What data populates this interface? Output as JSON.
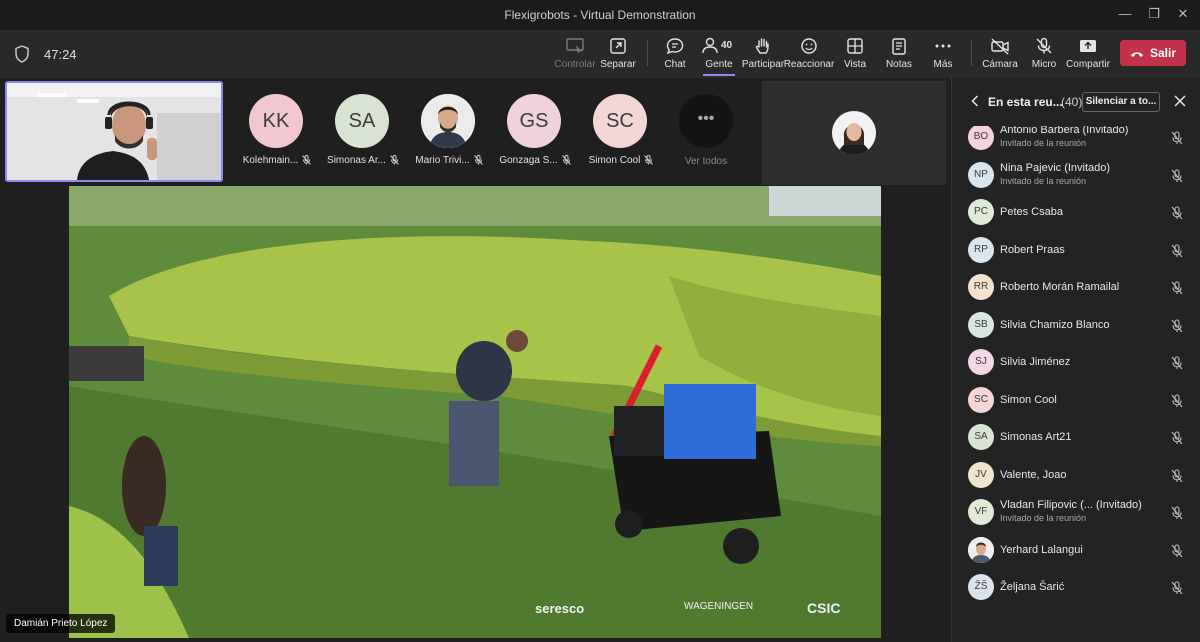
{
  "window": {
    "title": "Flexigrobots - Virtual Demonstration"
  },
  "toolbar": {
    "timer": "47:24",
    "items": [
      {
        "label": "Controlar",
        "icon": "control-icon"
      },
      {
        "label": "Separar",
        "icon": "popout-icon"
      },
      {
        "label": "Chat",
        "icon": "chat-icon"
      },
      {
        "label": "Gente",
        "icon": "people-icon",
        "count": "40"
      },
      {
        "label": "Participar",
        "icon": "raise-hand-icon"
      },
      {
        "label": "Reaccionar",
        "icon": "smiley-icon"
      },
      {
        "label": "Vista",
        "icon": "view-grid-icon"
      },
      {
        "label": "Notas",
        "icon": "notes-icon"
      },
      {
        "label": "Más",
        "icon": "more-icon"
      },
      {
        "label": "Cámara",
        "icon": "camera-off-icon"
      },
      {
        "label": "Micro",
        "icon": "mic-off-icon"
      },
      {
        "label": "Compartir",
        "icon": "share-icon"
      }
    ],
    "leave_label": "Salir"
  },
  "stage": {
    "participants": [
      {
        "initials": "KK",
        "name": "Kolehmain...",
        "color": "#f3c7cf"
      },
      {
        "initials": "SA",
        "name": "Simonas Ar...",
        "color": "#d9e3d3"
      },
      {
        "initials": "",
        "name": "Mario Trivi...",
        "color": "#f0f0f0"
      },
      {
        "initials": "GS",
        "name": "Gonzaga S...",
        "color": "#efd2dd"
      },
      {
        "initials": "SC",
        "name": "Simon Cool",
        "color": "#f5d6d6"
      }
    ],
    "see_all_label": "Ver todos",
    "presenter_name": "Damián Prieto López",
    "video_logos": [
      "seresco",
      "WAGENINGEN",
      "CSIC"
    ]
  },
  "panel": {
    "title": "En esta reu...",
    "count": "(40)",
    "mute_all_label": "Silenciar a to...",
    "people": [
      {
        "initials": "BO",
        "name": "Antonio Barberá",
        "suffix": "(Invitado)",
        "sub": "Invitado de la reunión",
        "color": "#f3d2dc"
      },
      {
        "initials": "NP",
        "name": "Nina Pajevic (Invitado)",
        "sub": "Invitado de la reunión",
        "color": "#d9e4ee"
      },
      {
        "initials": "PC",
        "name": "Petes Csaba",
        "sub": "",
        "color": "#e0ead8"
      },
      {
        "initials": "RP",
        "name": "Robert Praas",
        "sub": "",
        "color": "#dbe5ee"
      },
      {
        "initials": "RR",
        "name": "Roberto Morán Ramailal",
        "sub": "",
        "color": "#f5e2cf"
      },
      {
        "initials": "SB",
        "name": "Silvia Chamizo Blanco",
        "sub": "",
        "color": "#d9e6df"
      },
      {
        "initials": "SJ",
        "name": "Silvia Jiménez",
        "sub": "",
        "color": "#f3d7e6"
      },
      {
        "initials": "SC",
        "name": "Simon Cool",
        "sub": "",
        "color": "#f5d6d6"
      },
      {
        "initials": "SA",
        "name": "Simonas Art21",
        "sub": "",
        "color": "#d9e3d3"
      },
      {
        "initials": "JV",
        "name": "Valente, Joao",
        "sub": "",
        "color": "#f2e3cc"
      },
      {
        "initials": "VF",
        "name": "Vladan Filipovic (... (Invitado)",
        "sub": "Invitado de la reunión",
        "color": "#dfe9d6"
      },
      {
        "initials": "",
        "name": "Yerhard Lalangui",
        "sub": "",
        "color": "#f0f0f0"
      },
      {
        "initials": "ŽŠ",
        "name": "Željana Šarić",
        "sub": "",
        "color": "#dbe2ee"
      }
    ]
  },
  "colors": {
    "accent": "#8b8cf0",
    "leave": "#c4314b"
  }
}
